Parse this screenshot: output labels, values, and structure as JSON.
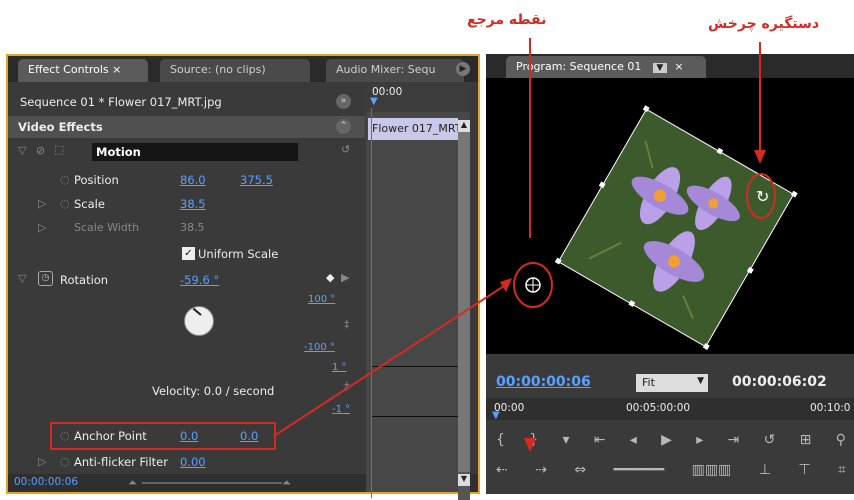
{
  "annotations": {
    "anchor_point": "نقطه مرجع",
    "rotation_handle": "دستگیره چرخش"
  },
  "left_panel": {
    "tabs": [
      "Effect Controls ×",
      "Source: (no clips)",
      "Audio Mixer: Sequ"
    ],
    "clip_title": "Sequence 01 * Flower 017_MRT.jpg",
    "timeline_time": "00:00",
    "timeline_clip": "Flower 017_MRT",
    "section": "Video Effects",
    "motion": "Motion",
    "position_label": "Position",
    "position_x": "86.0",
    "position_y": "375.5",
    "scale_label": "Scale",
    "scale_value": "38.5",
    "scale_width_label": "Scale Width",
    "scale_width_value": "38.5",
    "uniform_scale": "Uniform Scale",
    "rotation_label": "Rotation",
    "rotation_value": "-59.6 °",
    "rot_max": "100 °",
    "rot_min": "-100 °",
    "vel_max": "1 °",
    "vel_min": "-1 °",
    "velocity": "Velocity: 0.0 / second",
    "anchor_label": "Anchor Point",
    "anchor_x": "0.0",
    "anchor_y": "0.0",
    "antiflicker_label": "Anti-flicker Filter",
    "antiflicker_value": "0.00",
    "footer_time": "00:00:00:06"
  },
  "program": {
    "tab": "Program: Sequence 01",
    "current_time": "00:00:00:06",
    "zoom": "Fit",
    "duration": "00:00:06:02",
    "ruler": [
      "00:00",
      "00:05:00:00",
      "00:10:0"
    ]
  },
  "colors": {
    "accent": "#e8a327",
    "timecode": "#5aa0ff",
    "annotation": "#d42a22"
  }
}
